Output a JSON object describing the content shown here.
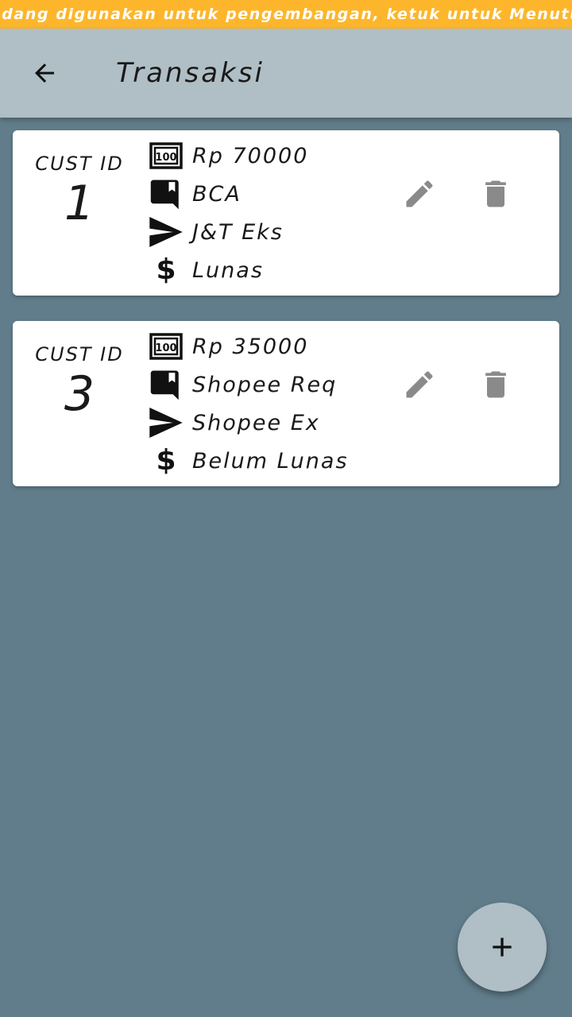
{
  "dev_banner": {
    "text": "Sedang digunakan untuk pengembangan, ketuk untuk Menutup"
  },
  "app_bar": {
    "title": "Transaksi",
    "back_icon": "arrow-back-icon"
  },
  "transactions": [
    {
      "cust_label": "CUST ID",
      "cust_id": "1",
      "amount": "Rp 70000",
      "bank": "BCA",
      "courier": "J&T Eks",
      "status": "Lunas"
    },
    {
      "cust_label": "CUST ID",
      "cust_id": "3",
      "amount": "Rp 35000",
      "bank": "Shopee Req",
      "courier": "Shopee Ex",
      "status": "Belum Lunas"
    }
  ],
  "icons": {
    "amount": "money-100-icon",
    "bank": "bookmark-comment-icon",
    "courier": "send-icon",
    "status": "dollar-icon",
    "edit": "pencil-icon",
    "delete": "trash-icon",
    "fab": "plus-icon"
  },
  "colors": {
    "banner": "#fdb62b",
    "app_bar": "#b0bec5",
    "background": "#617d8b",
    "card": "#ffffff",
    "action_icon": "#8a8a8a"
  }
}
